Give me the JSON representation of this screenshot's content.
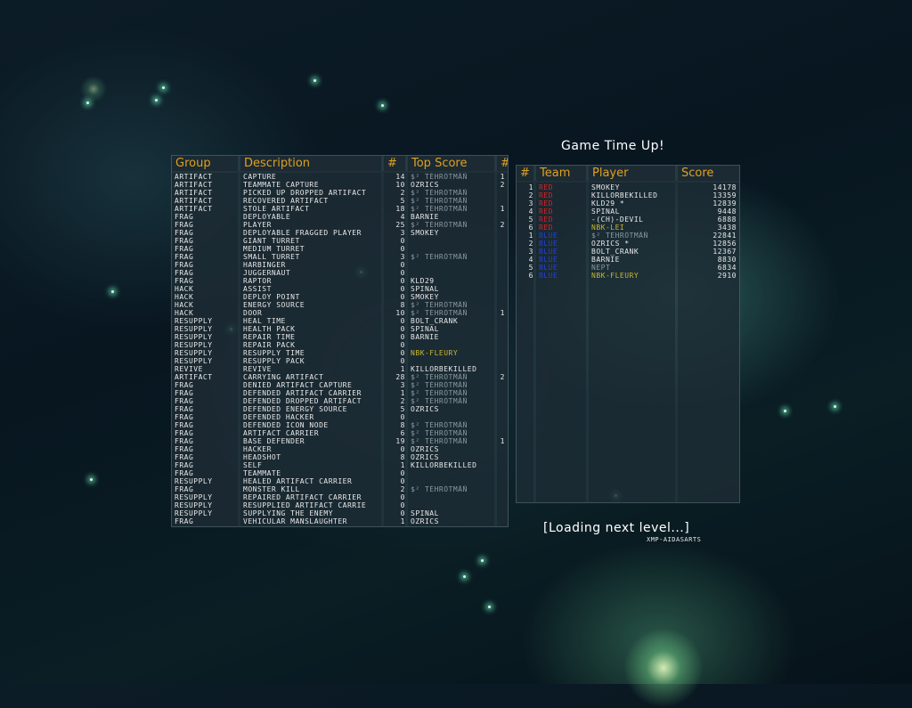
{
  "awards": {
    "headers": [
      "Group",
      "Description",
      "#",
      "Top Score",
      "#"
    ],
    "rows": [
      [
        "ARTIFACT",
        "CAPTURE",
        "14",
        "$² TÈHRÖTMÄÑ",
        "1"
      ],
      [
        "ARTIFACT",
        "TEAMMATE CAPTURE",
        "10",
        "OZRICS",
        "2"
      ],
      [
        "ARTIFACT",
        "PICKED UP DROPPED ARTIFACT",
        "2",
        "$² TÈHRÖTMÄÑ",
        ""
      ],
      [
        "ARTIFACT",
        "RECOVERED ARTIFACT",
        "5",
        "$² TÈHRÖTMÄÑ",
        ""
      ],
      [
        "ARTIFACT",
        "STOLE ARTIFACT",
        "18",
        "$² TÈHRÖTMÄÑ",
        "1"
      ],
      [
        "FRAG",
        "DEPLOYABLE",
        "4",
        "BARNIE",
        ""
      ],
      [
        "FRAG",
        "PLAYER",
        "25",
        "$² TÈHRÖTMÄÑ",
        "2"
      ],
      [
        "FRAG",
        "DEPLOYABLE FRAGGED PLAYER",
        "3",
        "SMOKEY",
        ""
      ],
      [
        "FRAG",
        "GIANT TURRET",
        "0",
        "",
        ""
      ],
      [
        "FRAG",
        "MEDIUM TURRET",
        "0",
        "",
        ""
      ],
      [
        "FRAG",
        "SMALL TURRET",
        "3",
        "$² TÈHRÖTMÄÑ",
        ""
      ],
      [
        "FRAG",
        "HARBINGER",
        "0",
        "",
        ""
      ],
      [
        "FRAG",
        "JUGGERNAUT",
        "0",
        "",
        ""
      ],
      [
        "FRAG",
        "RAPTOR",
        "0",
        "KLD29",
        ""
      ],
      [
        "HACK",
        "ASSIST",
        "0",
        "SPINAL",
        ""
      ],
      [
        "HACK",
        "DEPLOY POINT",
        "0",
        "SMOKEY",
        ""
      ],
      [
        "HACK",
        "ENERGY SOURCE",
        "8",
        "$² TÈHRÖTMÄÑ",
        ""
      ],
      [
        "HACK",
        "DOOR",
        "10",
        "$² TÈHRÖTMÄÑ",
        "1"
      ],
      [
        "RESUPPLY",
        "HEAL TIME",
        "0",
        "BOLT_CRANK",
        ""
      ],
      [
        "RESUPPLY",
        "HEALTH PACK",
        "0",
        "SPINAL",
        ""
      ],
      [
        "RESUPPLY",
        "REPAIR TIME",
        "0",
        "BARNIE",
        ""
      ],
      [
        "RESUPPLY",
        "REPAIR PACK",
        "0",
        "",
        ""
      ],
      [
        "RESUPPLY",
        "RESUPPLY TIME",
        "0",
        "NBK-FLEURY",
        ""
      ],
      [
        "RESUPPLY",
        "RESUPPLY PACK",
        "0",
        "",
        ""
      ],
      [
        "REVIVE",
        "REVIVE",
        "1",
        "KILLORBEKILLED",
        ""
      ],
      [
        "ARTIFACT",
        "CARRYING ARTIFACT",
        "28",
        "$² TÈHRÖTMÄÑ",
        "2"
      ],
      [
        "FRAG",
        "DENIED ARTIFACT CAPTURE",
        "3",
        "$² TÈHRÖTMÄÑ",
        ""
      ],
      [
        "FRAG",
        "DEFENDED ARTIFACT CARRIER",
        "1",
        "$² TÈHRÖTMÄÑ",
        ""
      ],
      [
        "FRAG",
        "DEFENDED DROPPED ARTIFACT",
        "2",
        "$² TÈHRÖTMÄÑ",
        ""
      ],
      [
        "FRAG",
        "DEFENDED ENERGY SOURCE",
        "5",
        "OZRICS",
        ""
      ],
      [
        "FRAG",
        "DEFENDED HACKER",
        "0",
        "",
        ""
      ],
      [
        "FRAG",
        "DEFENDED ICON NODE",
        "8",
        "$² TÈHRÖTMÄÑ",
        ""
      ],
      [
        "FRAG",
        "ARTIFACT CARRIER",
        "6",
        "$² TÈHRÖTMÄÑ",
        ""
      ],
      [
        "FRAG",
        "BASE DEFENDER",
        "19",
        "$² TÈHRÖTMÄÑ",
        "1"
      ],
      [
        "FRAG",
        "HACKER",
        "0",
        "OZRICS",
        ""
      ],
      [
        "FRAG",
        "HEADSHOT",
        "8",
        "OZRICS",
        ""
      ],
      [
        "FRAG",
        "SELF",
        "1",
        "KILLORBEKILLED",
        ""
      ],
      [
        "FRAG",
        "TEAMMATE",
        "0",
        "",
        ""
      ],
      [
        "RESUPPLY",
        "HEALED ARTIFACT CARRIER",
        "0",
        "",
        ""
      ],
      [
        "FRAG",
        "MONSTER KILL",
        "2",
        "$² TÈHRÖTMÄÑ",
        ""
      ],
      [
        "RESUPPLY",
        "REPAIRED ARTIFACT CARRIER",
        "0",
        "",
        ""
      ],
      [
        "RESUPPLY",
        "RESUPPLIED ARTIFACT CARRIE",
        "0",
        "",
        ""
      ],
      [
        "RESUPPLY",
        "SUPPLYING THE ENEMY",
        "0",
        "SPINAL",
        ""
      ],
      [
        "FRAG",
        "VEHICULAR MANSLAUGHTER",
        "1",
        "OZRICS",
        ""
      ]
    ]
  },
  "scoreboard": {
    "title": "Game Time Up!",
    "headers": [
      "#",
      "Team",
      "Player",
      "Score"
    ],
    "rows": [
      [
        "1",
        "RED",
        "SMOKEY",
        "14178"
      ],
      [
        "2",
        "RED",
        "KILLORBEKILLED",
        "13359"
      ],
      [
        "3",
        "RED",
        "KLD29 *",
        "12839"
      ],
      [
        "4",
        "RED",
        "SPINAL",
        "9448"
      ],
      [
        "5",
        "RED",
        "-(CH)-DEVIL",
        "6888"
      ],
      [
        "6",
        "RED",
        "NBK-LEI",
        "3438"
      ],
      [
        "1",
        "BLUE",
        "$² TÈHRÖTMÄÑ",
        "22841"
      ],
      [
        "2",
        "BLUE",
        "OZRICS *",
        "12856"
      ],
      [
        "3",
        "BLUE",
        "BOLT_CRANK",
        "12367"
      ],
      [
        "4",
        "BLUE",
        "BARNIE",
        "8830"
      ],
      [
        "5",
        "BLUE",
        "NEPT",
        "6834"
      ],
      [
        "6",
        "BLUE",
        "NBK-FLEURY",
        "2910"
      ]
    ]
  },
  "status": {
    "loading": "[Loading next level...]",
    "credit": "XMP-AIDASARTS"
  },
  "colors": {
    "header": "#e0a020",
    "red_team": "#e02020",
    "blue_team": "#2040e0",
    "grey_name": "#8a9aa0",
    "clan_name": "#c8b830"
  }
}
